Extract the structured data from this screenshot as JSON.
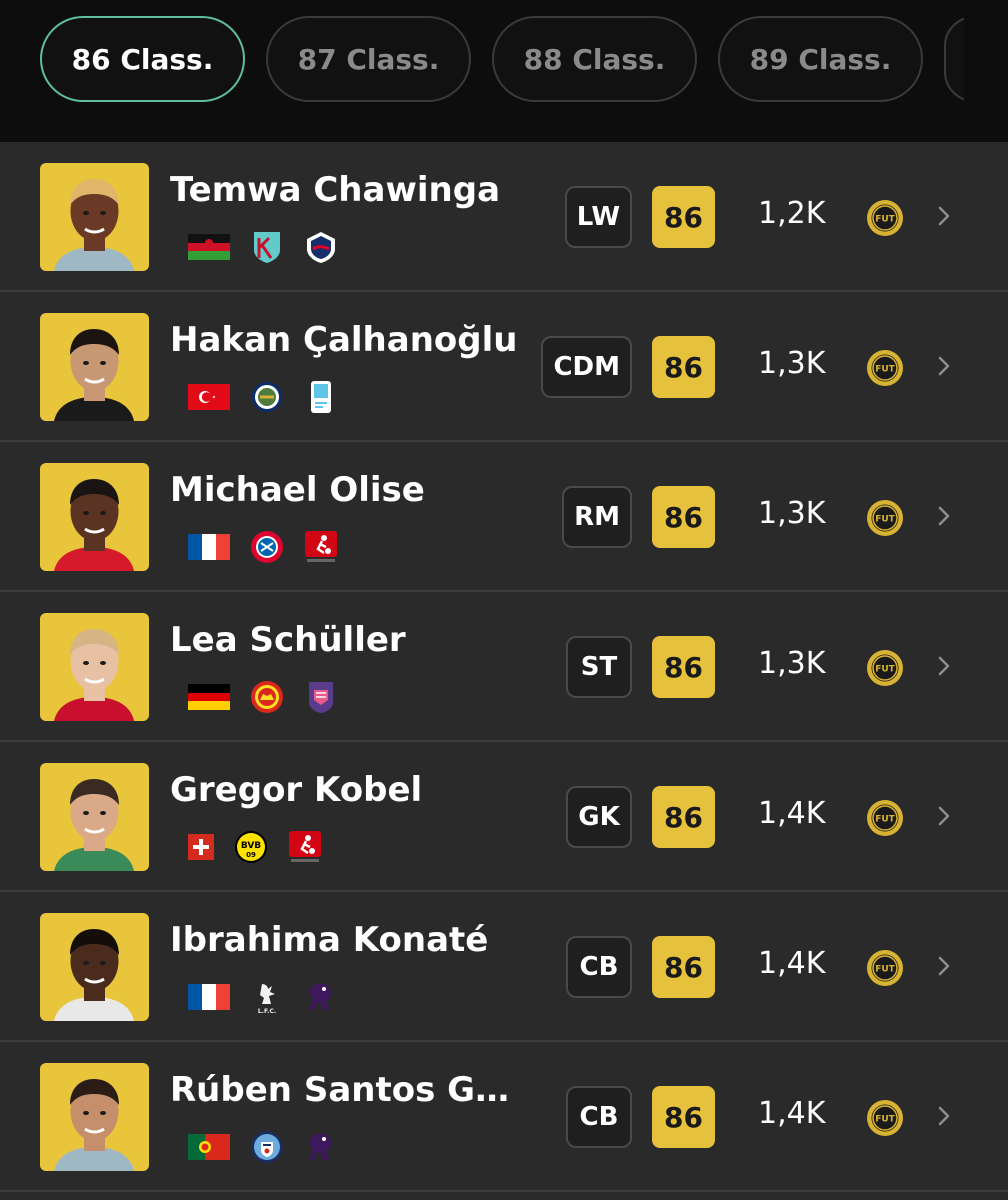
{
  "tabs": [
    {
      "label": "86 Class.",
      "active": true
    },
    {
      "label": "87 Class.",
      "active": false
    },
    {
      "label": "88 Class.",
      "active": false
    },
    {
      "label": "89 Class.",
      "active": false
    }
  ],
  "players": [
    {
      "name": "Temwa Chawinga",
      "position": "LW",
      "rating": "86",
      "price": "1,2K",
      "nation_flag": "malawi",
      "club": "kc-current-crest",
      "league": "nwsl-logo"
    },
    {
      "name": "Hakan Çalhanoğlu",
      "position": "CDM",
      "rating": "86",
      "price": "1,3K",
      "nation_flag": "turkey",
      "club": "inter-crest",
      "league": "serie-a-logo"
    },
    {
      "name": "Michael Olise",
      "position": "RM",
      "rating": "86",
      "price": "1,3K",
      "nation_flag": "france",
      "club": "bayern-crest",
      "league": "bundesliga-logo"
    },
    {
      "name": "Lea Schüller",
      "position": "ST",
      "rating": "86",
      "price": "1,3K",
      "nation_flag": "germany",
      "club": "man-united-crest",
      "league": "wsl-logo"
    },
    {
      "name": "Gregor Kobel",
      "position": "GK",
      "rating": "86",
      "price": "1,4K",
      "nation_flag": "switzerland",
      "club": "dortmund-crest",
      "league": "bundesliga-logo"
    },
    {
      "name": "Ibrahima Konaté",
      "position": "CB",
      "rating": "86",
      "price": "1,4K",
      "nation_flag": "france",
      "club": "liverpool-crest",
      "league": "premier-league-logo"
    },
    {
      "name": "Rúben Santos Gat...",
      "position": "CB",
      "rating": "86",
      "price": "1,4K",
      "nation_flag": "portugal",
      "club": "man-city-crest",
      "league": "premier-league-logo"
    }
  ],
  "colors": {
    "accent": "#5fbf9a",
    "rating_bg": "#e6c13b",
    "avatar_bg": "#e8c53a",
    "coin": "#d8b233"
  }
}
